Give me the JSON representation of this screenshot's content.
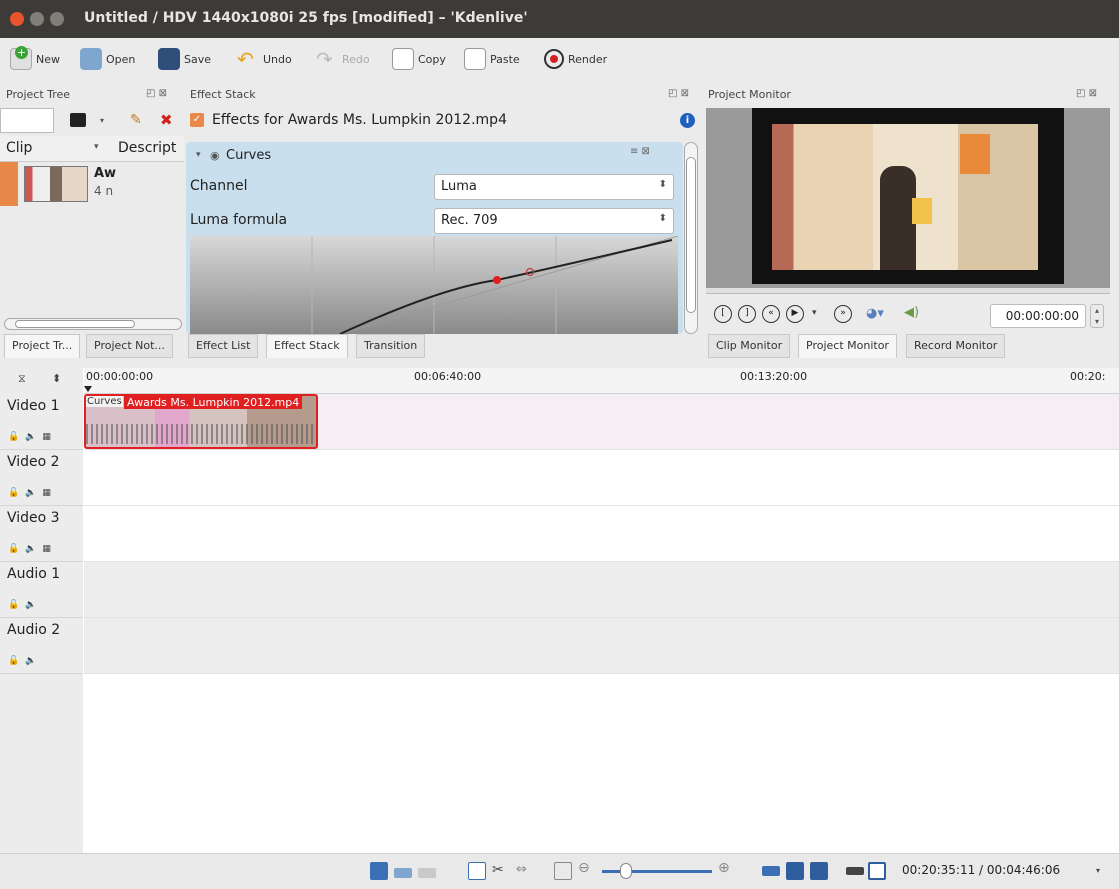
{
  "window": {
    "title": "Untitled / HDV 1440x1080i 25 fps [modified] – 'Kdenlive'"
  },
  "toolbar": {
    "new": "New",
    "open": "Open",
    "save": "Save",
    "undo": "Undo",
    "redo": "Redo",
    "copy": "Copy",
    "paste": "Paste",
    "render": "Render"
  },
  "project_tree": {
    "title": "Project Tree",
    "col_clip": "Clip",
    "col_desc": "Descript",
    "clip_name": "Aw",
    "clip_meta": "4 n",
    "tabs": [
      "Project Tr...",
      "Project Not..."
    ]
  },
  "effect_stack": {
    "title": "Effect Stack",
    "effects_for": "Effects for Awards Ms. Lumpkin 2012.mp4",
    "effect_name": "Curves",
    "channel_label": "Channel",
    "channel_value": "Luma",
    "formula_label": "Luma formula",
    "formula_value": "Rec. 709",
    "tabs": [
      "Effect List",
      "Effect Stack",
      "Transition"
    ]
  },
  "monitor": {
    "title": "Project Monitor",
    "timecode": "00:00:00:00",
    "tabs": [
      "Clip Monitor",
      "Project Monitor",
      "Record Monitor"
    ]
  },
  "timeline": {
    "ruler": [
      "00:00:00:00",
      "00:06:40:00",
      "00:13:20:00",
      "00:20:"
    ],
    "tracks": [
      {
        "name": "Video 1"
      },
      {
        "name": "Video 2"
      },
      {
        "name": "Video 3"
      },
      {
        "name": "Audio 1"
      },
      {
        "name": "Audio 2"
      }
    ],
    "clip_effect": "Curves",
    "clip_name": "Awards Ms. Lumpkin 2012.mp4"
  },
  "status": {
    "time": "00:20:35:11 / 00:04:46:06"
  },
  "colors": {
    "titlebar": "#3c3b37",
    "close": "#e8542e",
    "clip_border": "#e02020",
    "panel_blue": "#c9dfee",
    "video1_lane": "#f6eef5"
  }
}
